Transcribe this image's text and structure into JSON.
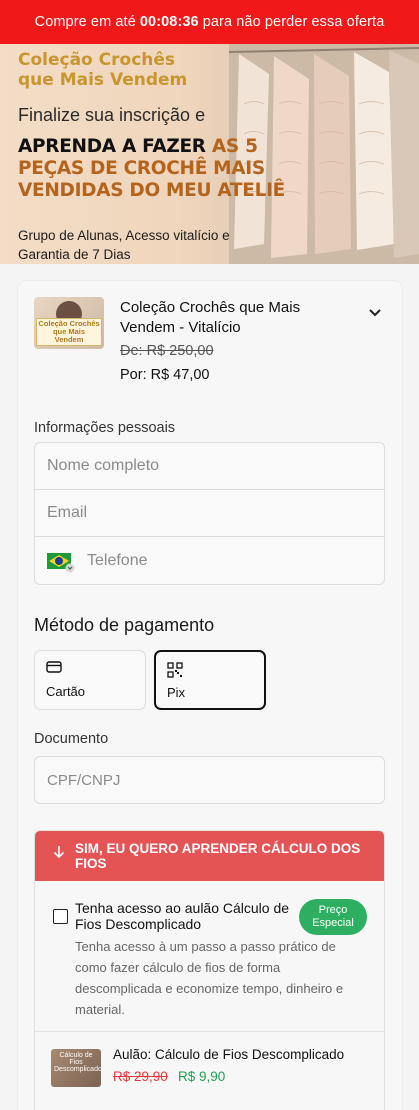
{
  "topbar": {
    "prefix": "Compre em até",
    "timer": "00:08:36",
    "suffix": "para não perder essa oferta",
    "color": "#f01818"
  },
  "hero": {
    "title_line1": "Coleção Crochês",
    "title_line2": "que Mais Vendem",
    "subtitle": "Finalize sua inscrição e",
    "headline_1": "APRENDA A FAZER",
    "headline_accent": "AS 5 PEÇAS DE CROCHÊ MAIS VENDIDAS DO MEU ATELIÊ",
    "footer": "Grupo de Alunas, Acesso vitalício e Garantia de 7 Dias"
  },
  "product": {
    "name": "Coleção Crochês que Mais Vendem - Vitalício",
    "thumb_label": "Coleção Crochês que Mais Vendem",
    "old_price": "De: R$ 250,00",
    "price": "Por: R$ 47,00",
    "expand_icon": "chevron-down-icon"
  },
  "personal": {
    "label": "Informações pessoais",
    "name_placeholder": "Nome completo",
    "email_placeholder": "Email",
    "phone_placeholder": "Telefone",
    "flag_icon": "brazil-flag-icon"
  },
  "payment": {
    "title": "Método de pagamento",
    "card_label": "Cartão",
    "pix_label": "Pix",
    "selected": "Pix"
  },
  "document": {
    "label": "Documento",
    "placeholder": "CPF/CNPJ"
  },
  "bump": {
    "header": "SIM, EU QUERO APRENDER CÁLCULO DOS FIOS",
    "header_color": "#e45454",
    "title": "Tenha acesso ao aulão Cálculo de Fios Descomplicado",
    "badge": "Preço Especial",
    "badge_color": "#2eae61",
    "description": "Tenha acesso à um passo a passo prático de como fazer cálculo de fios de forma descomplicada e economize tempo, dinheiro e material.",
    "item_thumb_label": "Cálculo de Fios Descomplicado",
    "item_title": "Aulão: Cálculo de Fios Descomplicado",
    "item_old_price": "R$ 29,90",
    "item_price": "R$ 9,90"
  }
}
